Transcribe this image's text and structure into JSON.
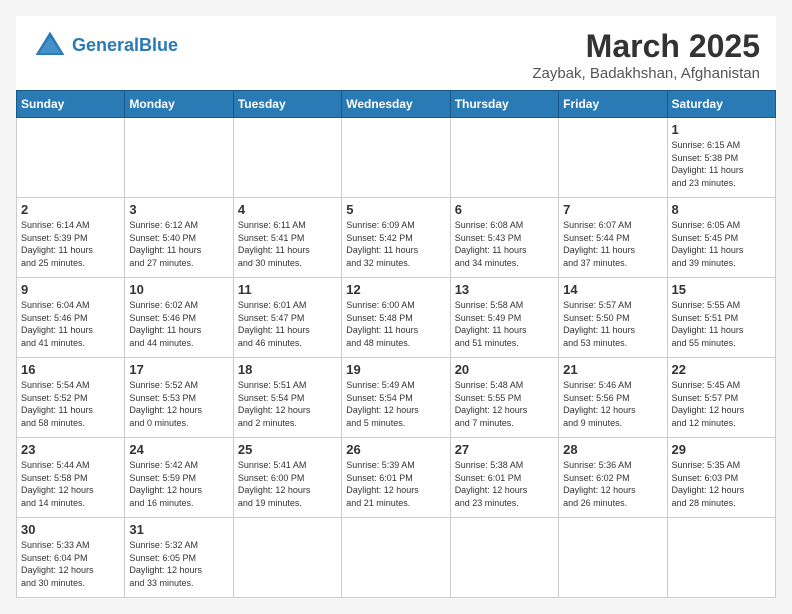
{
  "header": {
    "logo_general": "General",
    "logo_blue": "Blue",
    "month_title": "March 2025",
    "subtitle": "Zaybak, Badakhshan, Afghanistan"
  },
  "weekdays": [
    "Sunday",
    "Monday",
    "Tuesday",
    "Wednesday",
    "Thursday",
    "Friday",
    "Saturday"
  ],
  "weeks": [
    [
      {
        "day": "",
        "info": ""
      },
      {
        "day": "",
        "info": ""
      },
      {
        "day": "",
        "info": ""
      },
      {
        "day": "",
        "info": ""
      },
      {
        "day": "",
        "info": ""
      },
      {
        "day": "",
        "info": ""
      },
      {
        "day": "1",
        "info": "Sunrise: 6:15 AM\nSunset: 5:38 PM\nDaylight: 11 hours\nand 23 minutes."
      }
    ],
    [
      {
        "day": "2",
        "info": "Sunrise: 6:14 AM\nSunset: 5:39 PM\nDaylight: 11 hours\nand 25 minutes."
      },
      {
        "day": "3",
        "info": "Sunrise: 6:12 AM\nSunset: 5:40 PM\nDaylight: 11 hours\nand 27 minutes."
      },
      {
        "day": "4",
        "info": "Sunrise: 6:11 AM\nSunset: 5:41 PM\nDaylight: 11 hours\nand 30 minutes."
      },
      {
        "day": "5",
        "info": "Sunrise: 6:09 AM\nSunset: 5:42 PM\nDaylight: 11 hours\nand 32 minutes."
      },
      {
        "day": "6",
        "info": "Sunrise: 6:08 AM\nSunset: 5:43 PM\nDaylight: 11 hours\nand 34 minutes."
      },
      {
        "day": "7",
        "info": "Sunrise: 6:07 AM\nSunset: 5:44 PM\nDaylight: 11 hours\nand 37 minutes."
      },
      {
        "day": "8",
        "info": "Sunrise: 6:05 AM\nSunset: 5:45 PM\nDaylight: 11 hours\nand 39 minutes."
      }
    ],
    [
      {
        "day": "9",
        "info": "Sunrise: 6:04 AM\nSunset: 5:46 PM\nDaylight: 11 hours\nand 41 minutes."
      },
      {
        "day": "10",
        "info": "Sunrise: 6:02 AM\nSunset: 5:46 PM\nDaylight: 11 hours\nand 44 minutes."
      },
      {
        "day": "11",
        "info": "Sunrise: 6:01 AM\nSunset: 5:47 PM\nDaylight: 11 hours\nand 46 minutes."
      },
      {
        "day": "12",
        "info": "Sunrise: 6:00 AM\nSunset: 5:48 PM\nDaylight: 11 hours\nand 48 minutes."
      },
      {
        "day": "13",
        "info": "Sunrise: 5:58 AM\nSunset: 5:49 PM\nDaylight: 11 hours\nand 51 minutes."
      },
      {
        "day": "14",
        "info": "Sunrise: 5:57 AM\nSunset: 5:50 PM\nDaylight: 11 hours\nand 53 minutes."
      },
      {
        "day": "15",
        "info": "Sunrise: 5:55 AM\nSunset: 5:51 PM\nDaylight: 11 hours\nand 55 minutes."
      }
    ],
    [
      {
        "day": "16",
        "info": "Sunrise: 5:54 AM\nSunset: 5:52 PM\nDaylight: 11 hours\nand 58 minutes."
      },
      {
        "day": "17",
        "info": "Sunrise: 5:52 AM\nSunset: 5:53 PM\nDaylight: 12 hours\nand 0 minutes."
      },
      {
        "day": "18",
        "info": "Sunrise: 5:51 AM\nSunset: 5:54 PM\nDaylight: 12 hours\nand 2 minutes."
      },
      {
        "day": "19",
        "info": "Sunrise: 5:49 AM\nSunset: 5:54 PM\nDaylight: 12 hours\nand 5 minutes."
      },
      {
        "day": "20",
        "info": "Sunrise: 5:48 AM\nSunset: 5:55 PM\nDaylight: 12 hours\nand 7 minutes."
      },
      {
        "day": "21",
        "info": "Sunrise: 5:46 AM\nSunset: 5:56 PM\nDaylight: 12 hours\nand 9 minutes."
      },
      {
        "day": "22",
        "info": "Sunrise: 5:45 AM\nSunset: 5:57 PM\nDaylight: 12 hours\nand 12 minutes."
      }
    ],
    [
      {
        "day": "23",
        "info": "Sunrise: 5:44 AM\nSunset: 5:58 PM\nDaylight: 12 hours\nand 14 minutes."
      },
      {
        "day": "24",
        "info": "Sunrise: 5:42 AM\nSunset: 5:59 PM\nDaylight: 12 hours\nand 16 minutes."
      },
      {
        "day": "25",
        "info": "Sunrise: 5:41 AM\nSunset: 6:00 PM\nDaylight: 12 hours\nand 19 minutes."
      },
      {
        "day": "26",
        "info": "Sunrise: 5:39 AM\nSunset: 6:01 PM\nDaylight: 12 hours\nand 21 minutes."
      },
      {
        "day": "27",
        "info": "Sunrise: 5:38 AM\nSunset: 6:01 PM\nDaylight: 12 hours\nand 23 minutes."
      },
      {
        "day": "28",
        "info": "Sunrise: 5:36 AM\nSunset: 6:02 PM\nDaylight: 12 hours\nand 26 minutes."
      },
      {
        "day": "29",
        "info": "Sunrise: 5:35 AM\nSunset: 6:03 PM\nDaylight: 12 hours\nand 28 minutes."
      }
    ],
    [
      {
        "day": "30",
        "info": "Sunrise: 5:33 AM\nSunset: 6:04 PM\nDaylight: 12 hours\nand 30 minutes."
      },
      {
        "day": "31",
        "info": "Sunrise: 5:32 AM\nSunset: 6:05 PM\nDaylight: 12 hours\nand 33 minutes."
      },
      {
        "day": "",
        "info": ""
      },
      {
        "day": "",
        "info": ""
      },
      {
        "day": "",
        "info": ""
      },
      {
        "day": "",
        "info": ""
      },
      {
        "day": "",
        "info": ""
      }
    ]
  ]
}
